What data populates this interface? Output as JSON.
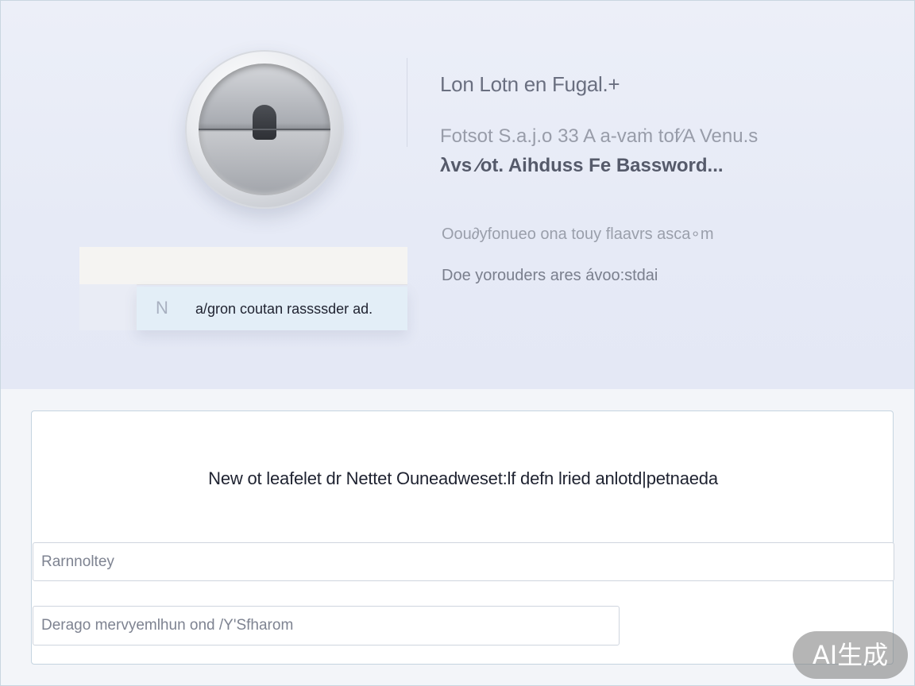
{
  "hero": {
    "title": "Lon Lotn en Fugal.+",
    "subtitle_line1": "Fotsot S.a.j.o 33 A a-vaṁ tof∕A Venu.s",
    "subtitle_line2": "λvs ∕ot. Aihduss Fe Bassword...",
    "description_line1": "Oou∂yfonueo ona touy flaavrs asca∘m",
    "description_line2": "Doe yorouders ares ávoo:stdai",
    "suggestion": {
      "icon": "N",
      "text": "a/gron coutan rassssder ad."
    }
  },
  "panel": {
    "message": "New ot leafelet dr Nettet Ouneadweset:lf defn lried anlotd|petnaeda",
    "input1_placeholder": "Rarnnoltey",
    "input2_placeholder": "Derago mervyemlhun ond /Y'Sfharom"
  },
  "badge": {
    "text": "AI生成"
  },
  "colors": {
    "hero_background": "#e6eaf6",
    "panel_border": "#c5d4e0",
    "suggestion_background": "#e3eef7"
  }
}
